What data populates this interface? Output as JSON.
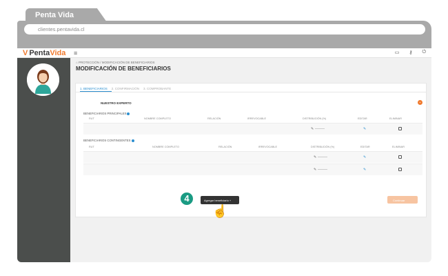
{
  "browser": {
    "tab_title": "Penta Vida",
    "url": "clientes.pentavida.cl"
  },
  "app": {
    "logo_part1": "Penta ",
    "logo_part2": "Vida",
    "menu_icon": "hamburger-icon",
    "toolbar_icons": [
      "id-card-icon",
      "key-icon",
      "power-icon"
    ]
  },
  "page": {
    "breadcrumb": "PROTECCIÓN / MODIFICACIÓN DE BENEFICIARIOS",
    "title": "MODIFICACIÓN DE BENEFICIARIOS"
  },
  "steps": [
    {
      "label": "1. BENEFICIARIOS",
      "active": true
    },
    {
      "label": "2. CONFIRMACIÓN",
      "active": false
    },
    {
      "label": "3. COMPROBANTE",
      "active": false
    }
  ],
  "expert": {
    "label": "NUESTRO EXPERTO"
  },
  "principal": {
    "title": "BENEFICIARIOS PRINCIPALES",
    "headers": [
      "RUT",
      "NOMBRE COMPLETO",
      "RELACIÓN",
      "IRREVOCABLE",
      "DISTRIBUCIÓN (%)",
      "EDITAR",
      "ELIMINAR"
    ]
  },
  "contingent": {
    "title": "BENEFICIARIOS CONTINGENTES",
    "headers": [
      "RUT",
      "NOMBRE COMPLETO",
      "RELACIÓN",
      "IRREVOCABLE",
      "DISTRIBUCIÓN (%)",
      "EDITAR",
      "ELIMINAR"
    ]
  },
  "actions": {
    "add_label": "Agregar beneficiario +",
    "continue_label": "Continuar",
    "step_badge": "4"
  },
  "colors": {
    "accent": "#f07a2e",
    "link": "#2b8fd0",
    "sidebar": "#4b4e4c",
    "badge": "#1a9b83"
  }
}
